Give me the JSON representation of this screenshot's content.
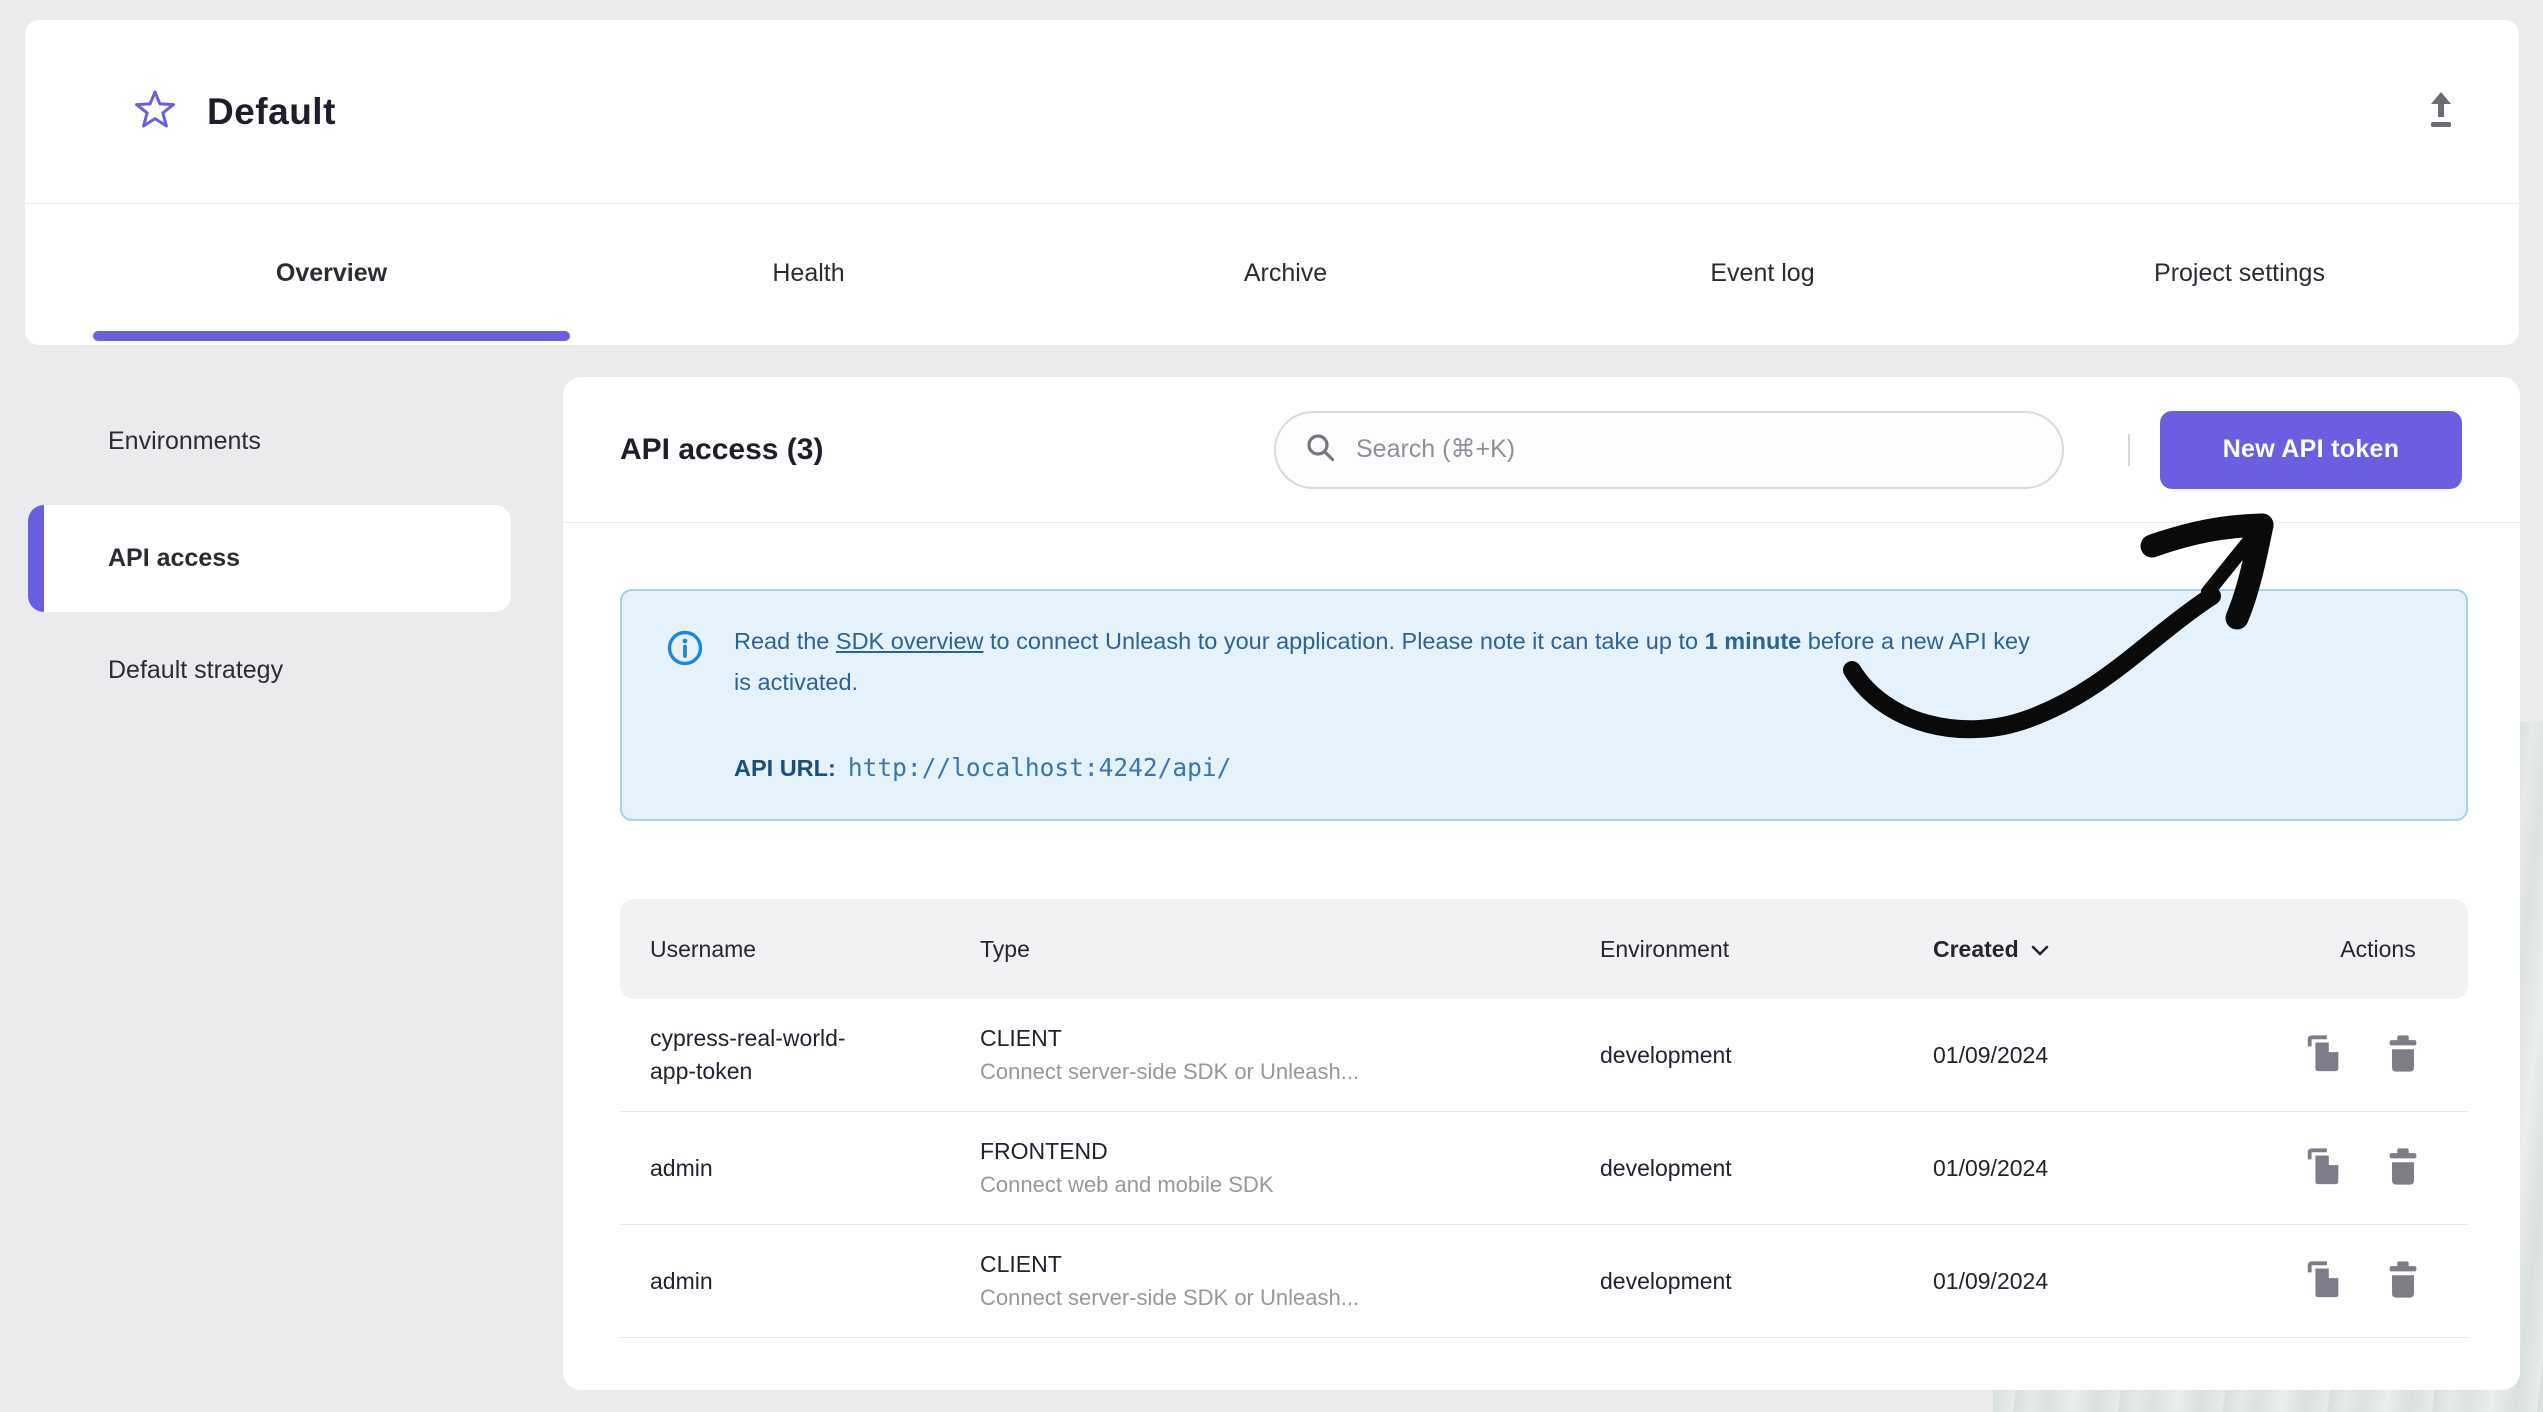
{
  "header": {
    "project_name": "Default",
    "tabs": [
      {
        "label": "Overview",
        "active": true
      },
      {
        "label": "Health",
        "active": false
      },
      {
        "label": "Archive",
        "active": false
      },
      {
        "label": "Event log",
        "active": false
      },
      {
        "label": "Project settings",
        "active": false
      }
    ]
  },
  "sidebar": {
    "items": [
      {
        "label": "Environments",
        "active": false
      },
      {
        "label": "API access",
        "active": true
      },
      {
        "label": "Default strategy",
        "active": false
      }
    ]
  },
  "main": {
    "heading": "API access (3)",
    "search": {
      "placeholder": "Search (⌘+K)"
    },
    "new_token_button": "New API token",
    "info": {
      "before_link": "Read the ",
      "link": "SDK overview",
      "middle": " to connect Unleash to your application. Please note it can take up to ",
      "bold": "1 minute",
      "after_bold": " before a new API key",
      "line2": "is activated.",
      "api_url_label": "API URL:",
      "api_url": "http://localhost:4242/api/"
    },
    "table": {
      "columns": [
        "Username",
        "Type",
        "Environment",
        "Created",
        "Actions"
      ],
      "sorted_column": "Created",
      "rows": [
        {
          "username": "cypress-real-world-app-token",
          "type": "CLIENT",
          "type_description": "Connect server-side SDK or Unleash...",
          "environment": "development",
          "created": "01/09/2024"
        },
        {
          "username": "admin",
          "type": "FRONTEND",
          "type_description": "Connect web and mobile SDK",
          "environment": "development",
          "created": "01/09/2024"
        },
        {
          "username": "admin",
          "type": "CLIENT",
          "type_description": "Connect server-side SDK or Unleash...",
          "environment": "development",
          "created": "01/09/2024"
        }
      ]
    }
  },
  "icons": {
    "star": "star-outline",
    "export": "upload-arrow",
    "search": "magnifier",
    "info": "info-circle",
    "sort": "chevron-down",
    "copy": "copy-document",
    "delete": "trash-can"
  },
  "colors": {
    "accent_purple": "#6a5fe0",
    "page_background": "#ebebed",
    "info_background": "#e5f2fc",
    "info_border": "#a5d0ee",
    "info_text": "#2d6295",
    "info_icon_blue": "#1e87dd",
    "table_header_background": "#f2f2f4",
    "icon_gray": "#7d7d89",
    "arrow_black": "#0a0a0a"
  }
}
